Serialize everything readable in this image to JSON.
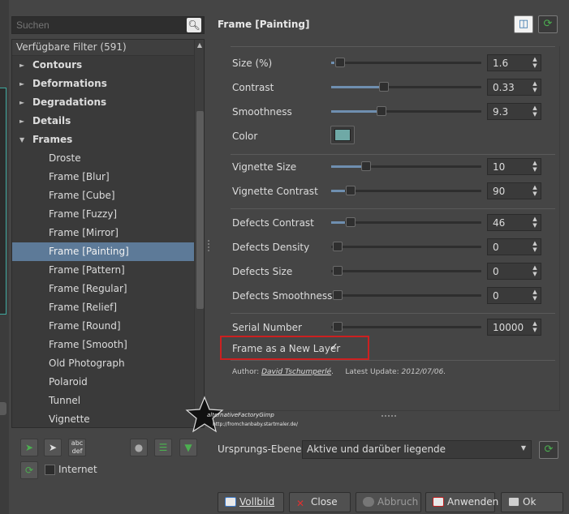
{
  "search": {
    "placeholder": "Suchen"
  },
  "filter_list": {
    "header": "Verfügbare Filter (591)",
    "categories": [
      {
        "label": "Contours",
        "expanded": false
      },
      {
        "label": "Deformations",
        "expanded": false
      },
      {
        "label": "Degradations",
        "expanded": false
      },
      {
        "label": "Details",
        "expanded": false
      },
      {
        "label": "Frames",
        "expanded": true
      }
    ],
    "items": [
      {
        "label": "Droste",
        "selected": false
      },
      {
        "label": "Frame [Blur]",
        "selected": false
      },
      {
        "label": "Frame [Cube]",
        "selected": false
      },
      {
        "label": "Frame [Fuzzy]",
        "selected": false
      },
      {
        "label": "Frame [Mirror]",
        "selected": false
      },
      {
        "label": "Frame [Painting]",
        "selected": true
      },
      {
        "label": "Frame [Pattern]",
        "selected": false
      },
      {
        "label": "Frame [Regular]",
        "selected": false
      },
      {
        "label": "Frame [Relief]",
        "selected": false
      },
      {
        "label": "Frame [Round]",
        "selected": false
      },
      {
        "label": "Frame [Smooth]",
        "selected": false
      },
      {
        "label": "Old Photograph",
        "selected": false
      },
      {
        "label": "Polaroid",
        "selected": false
      },
      {
        "label": "Tunnel",
        "selected": false
      },
      {
        "label": "Vignette",
        "selected": false
      }
    ]
  },
  "left_toolbar": {
    "internet_label": "Internet",
    "internet_checked": false,
    "icons": [
      "add-favorite-icon",
      "remove-favorite-icon",
      "rename-icon",
      "visibility-icon",
      "list-icon",
      "download-icon",
      "refresh-icon"
    ]
  },
  "filter_panel": {
    "title": "Frame [Painting]",
    "params": {
      "size": {
        "label": "Size (%)",
        "value": "1.6",
        "fraction": 0.02
      },
      "contrast": {
        "label": "Contrast",
        "value": "0.33",
        "fraction": 0.33
      },
      "smoothness": {
        "label": "Smoothness",
        "value": "9.3",
        "fraction": 0.31
      },
      "color": {
        "label": "Color",
        "value": "#6fa9a6"
      },
      "vignette_size": {
        "label": "Vignette Size",
        "value": "10",
        "fraction": 0.2
      },
      "vignette_contrast": {
        "label": "Vignette Contrast",
        "value": "90",
        "fraction": 0.09
      },
      "defects_contrast": {
        "label": "Defects Contrast",
        "value": "46",
        "fraction": 0.09
      },
      "defects_density": {
        "label": "Defects Density",
        "value": "0",
        "fraction": 0.0
      },
      "defects_size": {
        "label": "Defects Size",
        "value": "0",
        "fraction": 0.0
      },
      "defects_smoothness": {
        "label": "Defects Smoothness",
        "value": "0",
        "fraction": 0.0
      },
      "serial_number": {
        "label": "Serial Number",
        "value": "10000",
        "fraction": 0.0
      }
    },
    "new_layer": {
      "label": "Frame as a New Layer",
      "checked": true
    },
    "author": {
      "prefix": "Author:",
      "name": "David Tschumperlé",
      "update_prefix": "Latest Update:",
      "date": "2012/07/06."
    }
  },
  "watermark": {
    "text": "alternativeFactoryGimp",
    "url": "http://fromchanbaby.startmaler.de/"
  },
  "input_layers": {
    "label": "Ursprungs-Ebenen",
    "selected": "Aktive und darüber liegende"
  },
  "buttons": {
    "preview": "Vollbild",
    "close": "Close",
    "cancel": "Abbruch",
    "apply": "Anwenden",
    "ok": "Ok"
  },
  "colors": {
    "accent": "#5d7a98",
    "highlight": "#cc2020",
    "green": "#3c9a3c"
  }
}
